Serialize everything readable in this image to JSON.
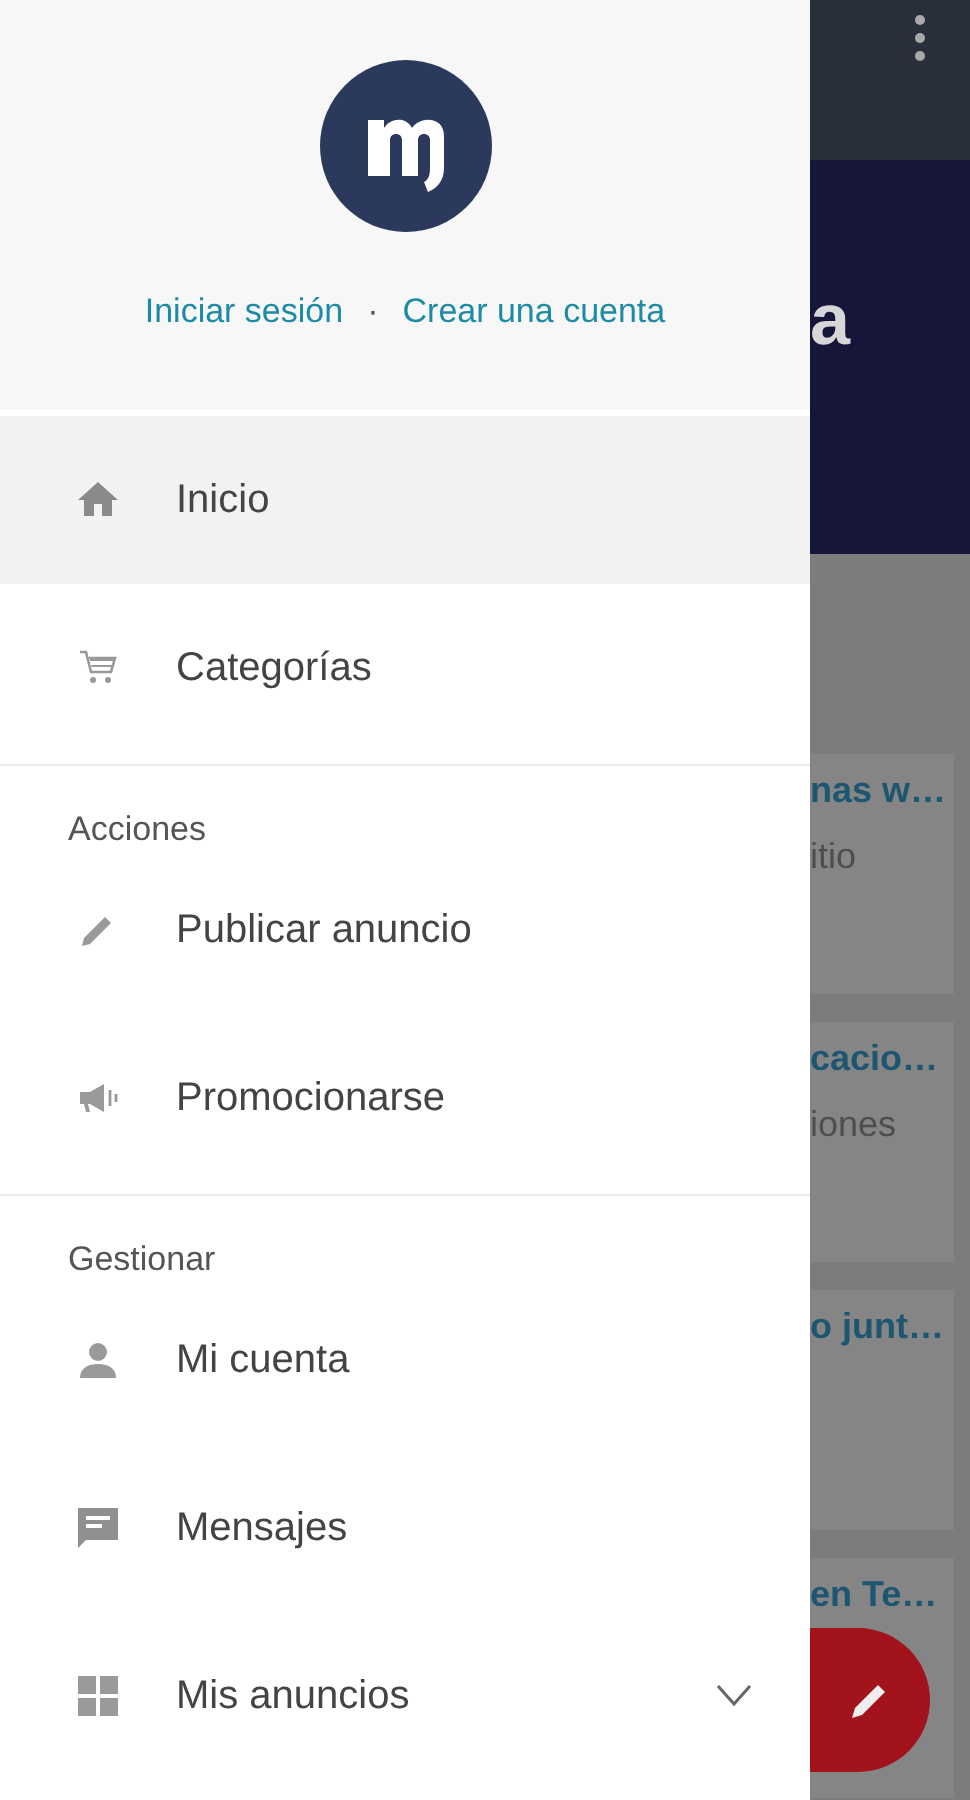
{
  "drawer": {
    "header": {
      "links": [
        {
          "label": "Iniciar sesión"
        },
        {
          "label": "Crear una cuenta"
        }
      ],
      "separator": "·"
    },
    "sections": [
      {
        "items": [
          {
            "label": "Inicio",
            "kind": "home",
            "selected": true
          },
          {
            "label": "Categorías",
            "kind": "cart",
            "selected": false
          }
        ]
      },
      {
        "title": "Acciones",
        "items": [
          {
            "label": "Publicar anuncio",
            "kind": "pencil",
            "selected": false
          },
          {
            "label": "Promocionarse",
            "kind": "megaphone",
            "selected": false
          }
        ]
      },
      {
        "title": "Gestionar",
        "items": [
          {
            "label": "Mi cuenta",
            "kind": "person",
            "selected": false
          },
          {
            "label": "Mensajes",
            "kind": "message",
            "selected": false
          },
          {
            "label": "Mis anuncios",
            "kind": "grid",
            "selected": false,
            "expanded": false
          }
        ]
      }
    ]
  },
  "background": {
    "title_fragment": "a",
    "cards": [
      {
        "title": "nas w…",
        "subtitle": "itio"
      },
      {
        "title": "cacio…",
        "subtitle": "iones"
      },
      {
        "title": "o junt…"
      },
      {
        "title": "en Te…"
      }
    ]
  }
}
